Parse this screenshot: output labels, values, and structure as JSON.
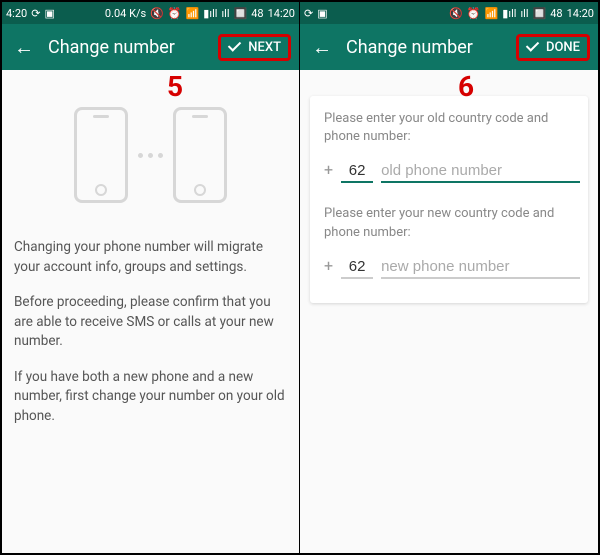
{
  "status": {
    "time_left": "4:20",
    "speed": "0.04 K/s",
    "battery": "48",
    "time_right": "14:20"
  },
  "left": {
    "title": "Change number",
    "action": "NEXT",
    "step": "5",
    "p1": "Changing your phone number will migrate your account info, groups and settings.",
    "p2": "Before proceeding, please confirm that you are able to receive SMS or calls at your new number.",
    "p3": "If you have both a new phone and a new number, first change your number on your old phone."
  },
  "right": {
    "title": "Change number",
    "action": "DONE",
    "step": "6",
    "label_old": "Please enter your old country code and phone number:",
    "cc_old": "62",
    "ph_old": "old phone number",
    "label_new": "Please enter your new country code and phone number:",
    "cc_new": "62",
    "ph_new": "new phone number"
  }
}
